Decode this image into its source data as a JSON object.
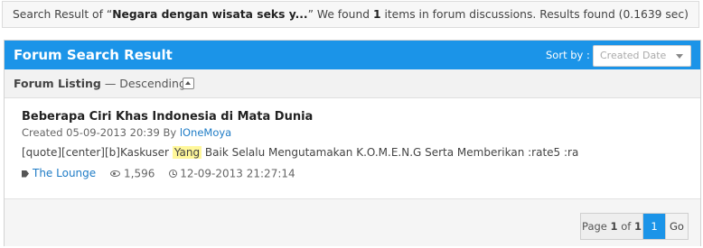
{
  "summary": {
    "prefix": "Search Result of “",
    "query": "Negara dengan wisata seks y...",
    "mid": "” We found ",
    "count": "1",
    "suffix": " items in forum discussions. Results found (0.1639 sec)"
  },
  "panel": {
    "title": "Forum Search Result",
    "sort_label": "Sort by :",
    "sort_value": "Created Date"
  },
  "listing": {
    "label": "Forum Listing",
    "order": " — Descending"
  },
  "result": {
    "title": "Beberapa Ciri Khas Indonesia di Mata Dunia",
    "created_prefix": "Created 05-09-2013 20:39 By ",
    "author": "lOneMoya",
    "snippet_before": "[quote][center][b]Kaskuser ",
    "snippet_highlight": "Yang",
    "snippet_after": " Baik Selalu Mengutamakan K.O.M.E.N.G Serta Memberikan :rate5 :ra",
    "category": "The Lounge",
    "views": "1,596",
    "date": "12-09-2013 21:27:14"
  },
  "pagination": {
    "info_prefix": "Page ",
    "current": "1",
    "info_mid": " of ",
    "total": "1",
    "page_button": "1",
    "go_label": "Go"
  },
  "icons": {
    "category": "tag-icon",
    "views": "eye-icon",
    "date": "clock-icon",
    "sort": "chevron-down-icon",
    "collapse": "chevron-up-icon"
  },
  "colors": {
    "accent": "#1b94e8",
    "highlight": "#fff79a",
    "link": "#1f7cc6"
  }
}
